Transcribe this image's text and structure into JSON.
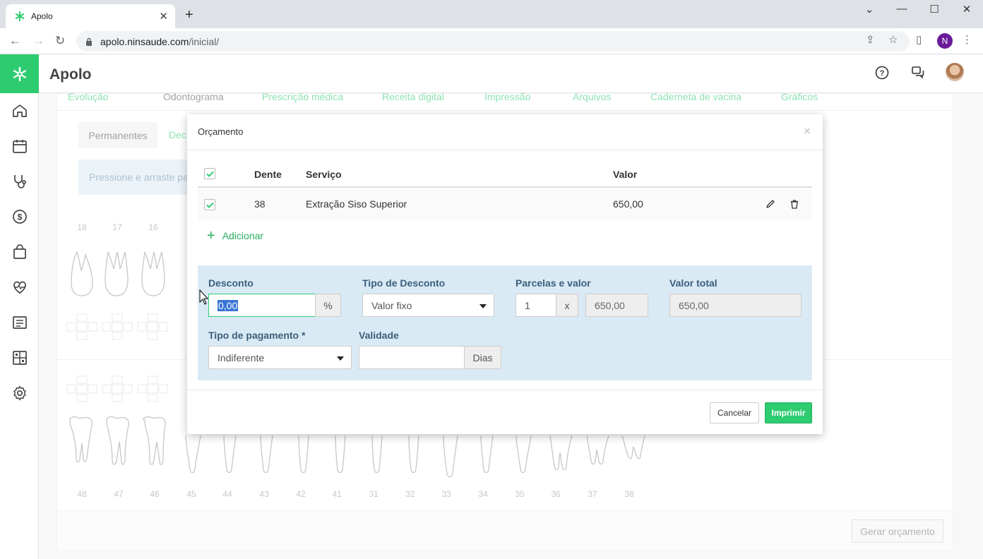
{
  "browser": {
    "tab_title": "Apolo",
    "tab_close": "✕",
    "new_tab": "+",
    "url_domain": "apolo.ninsaude.com",
    "url_path": "/inicial/",
    "profile_initial": "N"
  },
  "app": {
    "title": "Apolo",
    "brand_color": "#2ecc71"
  },
  "sidebar": {
    "items": [
      {
        "icon": "home-icon"
      },
      {
        "icon": "calendar-icon"
      },
      {
        "icon": "stethoscope-icon"
      },
      {
        "icon": "dollar-icon"
      },
      {
        "icon": "shopping-bag-icon"
      },
      {
        "icon": "heart-pulse-icon"
      },
      {
        "icon": "document-list-icon"
      },
      {
        "icon": "grid-icon"
      },
      {
        "icon": "gear-icon"
      }
    ]
  },
  "background": {
    "top_tabs": [
      "Evolução",
      "Odontograma",
      "Prescrição médica",
      "Receita digital",
      "Impressão",
      "Arquivos",
      "Caderneta de vacina",
      "Gráficos"
    ],
    "segment_permanent": "Permanentes",
    "segment_deciduous": "Dec",
    "hint_text": "Pressione e arraste pa",
    "upper_teeth": [
      "18",
      "17",
      "16"
    ],
    "lower_teeth": [
      "48",
      "47",
      "46",
      "45",
      "44",
      "43",
      "42",
      "41",
      "31",
      "32",
      "33",
      "34",
      "35",
      "36",
      "37",
      "38"
    ],
    "generate_button": "Gerar orçamento"
  },
  "modal": {
    "title": "Orçamento",
    "close": "×",
    "columns": {
      "tooth": "Dente",
      "service": "Serviço",
      "value": "Valor"
    },
    "rows": [
      {
        "tooth": "38",
        "service": "Extração Siso Superior",
        "value": "650,00",
        "checked": true
      }
    ],
    "add_label": "Adicionar",
    "form": {
      "discount_label": "Desconto",
      "discount_value": "0,00",
      "discount_addon": "%",
      "discount_type_label": "Tipo de Desconto",
      "discount_type_value": "Valor fixo",
      "installments_label": "Parcelas e valor",
      "installments_count": "1",
      "installments_x": "x",
      "installments_value": "650,00",
      "total_label": "Valor total",
      "total_value": "650,00",
      "payment_type_label": "Tipo de pagamento *",
      "payment_type_value": "Indiferente",
      "validity_label": "Validade",
      "validity_value": "",
      "validity_addon": "Dias"
    },
    "cancel_button": "Cancelar",
    "print_button": "Imprimir"
  }
}
